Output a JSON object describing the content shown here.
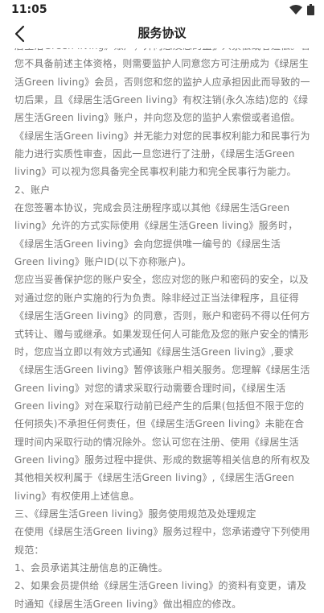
{
  "status_bar": {
    "time": "11:05",
    "wifi_icon": "wifi-icon",
    "battery_icon": "battery-icon"
  },
  "header": {
    "title": "服务协议",
    "back_icon": "back-arrow-icon"
  },
  "agreement": {
    "paragraphs": [
      "居生活Green living》账户，并向您及您的监护人索偿或者追偿。若您不具备前述主体资格，则需要监护人同意您方可注册成为《绿居生活Green living》会员，否则您和您的监护人应承担因此而导致的一切后果，且《绿居生活Green living》有权注销(永久冻结)您的《绿居生活Green living》账户，并向您及您的监护人索偿或者追偿。",
      "《绿居生活Green living》并无能力对您的民事权利能力和民事行为能力进行实质性审查，因此一旦您进行了注册，《绿居生活Green living》可以视为您具备完全民事权利能力和完全民事行为能力。",
      "2、账户",
      "在您签署本协议，完成会员注册程序或以其他《绿居生活Green living》允许的方式实际使用《绿居生活Green living》服务时，《绿居生活Green living》会向您提供唯一编号的《绿居生活Green living》账户ID(以下亦称账户)。",
      "您应当妥善保护您的账户安全，您应对您的账户和密码的安全，以及对通过您的账户实施的行为负责。除非经过正当法律程序，且征得《绿居生活Green living》的同意，否则，账户和密码不得以任何方式转让、赠与或继承。如果发现任何人可能危及您的账户安全的情形时，您应当立即以有效方式通知《绿居生活Green living》,要求《绿居生活Green living》暂停该账户相关服务。您理解《绿居生活Green living》对您的请求采取行动需要合理时间，《绿居生活Green living》对在采取行动前已经产生的后果(包括但不限于您的任何损失)不承担任何责任，但《绿居生活Green living》未能在合理时间内采取行动的情况除外。您认可您在注册、使用《绿居生活Green living》服务过程中提供、形成的数据等相关信息的所有权及其他相关权利属于《绿居生活Green living》,《绿居生活Green living》有权使用上述信息。",
      "三、《绿居生活Green living》服务使用规范及处理规定",
      "在使用《绿居生活Green living》服务过程中，您承诺遵守下列使用规范：",
      "1、会员承诺其注册信息的正确性。",
      "2、如果会员提供给《绿居生活Green living》的资料有变更，请及时通知《绿居生活Green living》做出相应的修改。"
    ]
  }
}
